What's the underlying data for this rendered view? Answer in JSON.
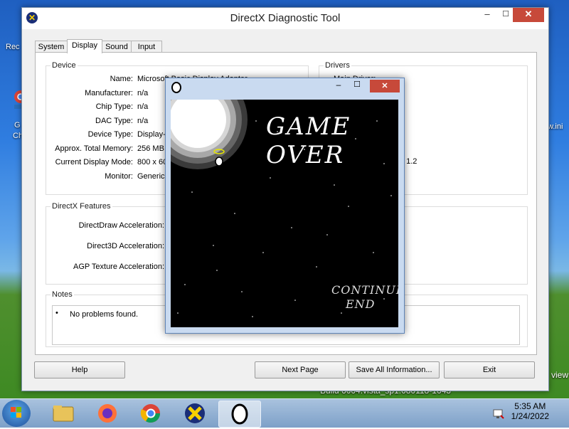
{
  "desktop": {
    "labels": [
      "Rec",
      "G",
      "Ch",
      "w.ini"
    ],
    "build_text": "Build 6004.vista_sp1.080118-1643",
    "build_suffix": "view"
  },
  "dxdiag": {
    "title": "DirectX Diagnostic Tool",
    "tabs": [
      "System",
      "Display",
      "Sound",
      "Input"
    ],
    "active_tab": "Display",
    "device": {
      "group_title": "Device",
      "rows": [
        {
          "label": "Name:",
          "value": "Microsoft Basic Display Adapter"
        },
        {
          "label": "Manufacturer:",
          "value": "n/a"
        },
        {
          "label": "Chip Type:",
          "value": "n/a"
        },
        {
          "label": "DAC Type:",
          "value": "n/a"
        },
        {
          "label": "Device Type:",
          "value": "Display-"
        },
        {
          "label": "Approx. Total Memory:",
          "value": "256 MB"
        },
        {
          "label": "Current Display Mode:",
          "value": "800 x 60"
        },
        {
          "label": "Monitor:",
          "value": "Generic"
        }
      ]
    },
    "drivers": {
      "group_title": "Drivers",
      "main_driver_label": "Main Driver:",
      "partial_values": [
        "a",
        "DDM 1.2"
      ]
    },
    "features": {
      "group_title": "DirectX Features",
      "rows": [
        {
          "label": "DirectDraw Acceleration:"
        },
        {
          "label": "Direct3D Acceleration:"
        },
        {
          "label": "AGP Texture Acceleration:"
        }
      ]
    },
    "notes": {
      "group_title": "Notes",
      "items": [
        "No problems found."
      ]
    },
    "buttons": {
      "help": "Help",
      "next_page": "Next Page",
      "save_all": "Save All Information...",
      "exit": "Exit"
    }
  },
  "game": {
    "game_over": "GAME OVER",
    "menu": [
      "CONTINUE",
      "END"
    ]
  },
  "taskbar": {
    "time": "5:35 AM",
    "date": "1/24/2022"
  },
  "colors": {
    "close_button": "#c7493a",
    "title_bar": "#ffffff",
    "window_bg": "#f0f0f0"
  }
}
